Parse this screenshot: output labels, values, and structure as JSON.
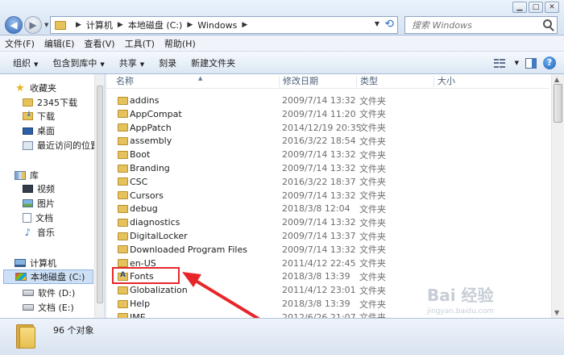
{
  "address": {
    "crumbs": [
      "计算机",
      "本地磁盘 (C:)",
      "Windows"
    ],
    "search_placeholder": "搜索 Windows"
  },
  "window_buttons": {
    "minimize": "▁",
    "maximize": "□",
    "close": "✕"
  },
  "menu": [
    "文件(F)",
    "编辑(E)",
    "查看(V)",
    "工具(T)",
    "帮助(H)"
  ],
  "toolbar": {
    "organize": "组织",
    "include_library": "包含到库中",
    "share": "共享",
    "burn": "刻录",
    "new_folder": "新建文件夹"
  },
  "nav": {
    "favorites": "收藏夹",
    "fav_items": [
      "2345下载",
      "下载",
      "桌面",
      "最近访问的位置"
    ],
    "libraries": "库",
    "lib_items": [
      "视频",
      "图片",
      "文档",
      "音乐"
    ],
    "computer": "计算机",
    "drives": [
      "本地磁盘 (C:)",
      "软件 (D:)",
      "文档 (E:)"
    ]
  },
  "columns": {
    "name": "名称",
    "date": "修改日期",
    "type": "类型",
    "size": "大小"
  },
  "files": [
    {
      "name": "addins",
      "date": "2009/7/14 13:32",
      "type": "文件夹"
    },
    {
      "name": "AppCompat",
      "date": "2009/7/14 11:20",
      "type": "文件夹"
    },
    {
      "name": "AppPatch",
      "date": "2014/12/19 20:35",
      "type": "文件夹"
    },
    {
      "name": "assembly",
      "date": "2016/3/22 18:54",
      "type": "文件夹"
    },
    {
      "name": "Boot",
      "date": "2009/7/14 13:32",
      "type": "文件夹"
    },
    {
      "name": "Branding",
      "date": "2009/7/14 13:32",
      "type": "文件夹"
    },
    {
      "name": "CSC",
      "date": "2016/3/22 18:37",
      "type": "文件夹"
    },
    {
      "name": "Cursors",
      "date": "2009/7/14 13:32",
      "type": "文件夹"
    },
    {
      "name": "debug",
      "date": "2018/3/8 12:04",
      "type": "文件夹"
    },
    {
      "name": "diagnostics",
      "date": "2009/7/14 13:32",
      "type": "文件夹"
    },
    {
      "name": "DigitalLocker",
      "date": "2009/7/14 13:37",
      "type": "文件夹"
    },
    {
      "name": "Downloaded Program Files",
      "date": "2009/7/14 13:32",
      "type": "文件夹"
    },
    {
      "name": "en-US",
      "date": "2011/4/12 22:45",
      "type": "文件夹"
    },
    {
      "name": "Fonts",
      "date": "2018/3/8 13:39",
      "type": "文件夹"
    },
    {
      "name": "Globalization",
      "date": "2011/4/12 23:01",
      "type": "文件夹"
    },
    {
      "name": "Help",
      "date": "2018/3/8 13:39",
      "type": "文件夹"
    },
    {
      "name": "IME",
      "date": "2012/6/26 21:07",
      "type": "文件夹"
    }
  ],
  "status": {
    "count": "96 个对象"
  },
  "watermark": {
    "main": "Bai 经验",
    "sub": "jingyan.baidu.com"
  },
  "colors": {
    "highlight": "#e8262a",
    "arrow": "#e8262a",
    "selection": "#cde0f6"
  }
}
